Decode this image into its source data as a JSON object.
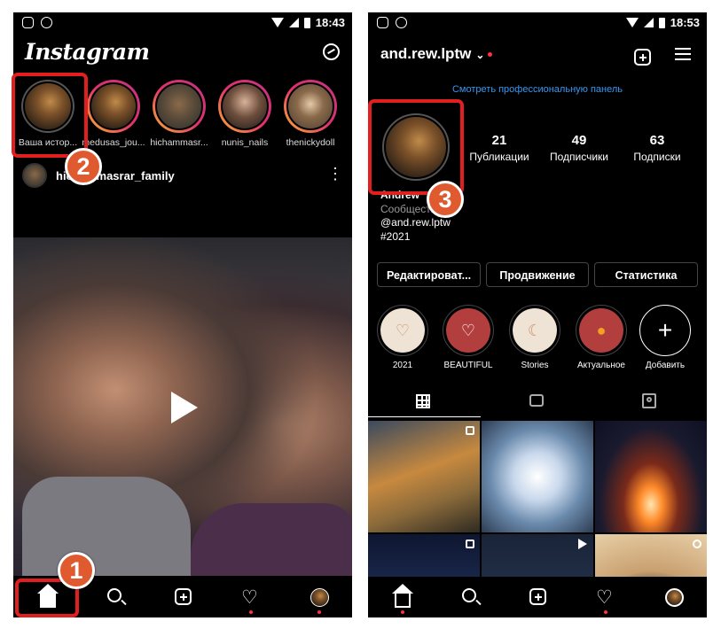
{
  "colors": {
    "accent_red": "#e21f1f",
    "badge": "#e05a30",
    "link_blue": "#3897f0",
    "notif_dot": "#ff3040"
  },
  "status_left": {
    "time": "18:43"
  },
  "status_right": {
    "time": "18:53"
  },
  "feed": {
    "logo": "Instagram",
    "messenger_icon": "messenger-icon",
    "stories": [
      {
        "label": "Ваша истор..."
      },
      {
        "label": "medusas_jou..."
      },
      {
        "label": "hichammasr..."
      },
      {
        "label": "nunis_nails"
      },
      {
        "label": "thenickydoll"
      }
    ],
    "post": {
      "username": "hichammasrar_family",
      "more": "⋮"
    },
    "play_icon": "play-icon"
  },
  "profile": {
    "username": "and.rew.lptw",
    "chevron": "⌄",
    "pro_panel_link": "Смотреть профессиональную панель",
    "stats": [
      {
        "value": "21",
        "label": "Публикации"
      },
      {
        "value": "49",
        "label": "Подписчики"
      },
      {
        "value": "63",
        "label": "Подписки"
      }
    ],
    "bio": {
      "name": "Andrew",
      "category": "Сообщество",
      "handle": "@and.rew.lptw",
      "tag": "#2021"
    },
    "buttons": {
      "edit": "Редактироват...",
      "promote": "Продвижение",
      "stats": "Статистика"
    },
    "highlights": [
      {
        "label": "2021",
        "glyph": "♡"
      },
      {
        "label": "BEAUTIFUL",
        "glyph": "♡"
      },
      {
        "label": "Stories",
        "glyph": "☾"
      },
      {
        "label": "Актуальное",
        "glyph": "●"
      },
      {
        "label": "Добавить",
        "glyph": "+"
      }
    ]
  },
  "nav": {
    "home": "home-icon",
    "search": "search-icon",
    "add": "add-icon",
    "activity": "heart-icon",
    "profile": "profile-icon"
  },
  "annotations": {
    "step1": "1",
    "step2": "2",
    "step3": "3"
  }
}
